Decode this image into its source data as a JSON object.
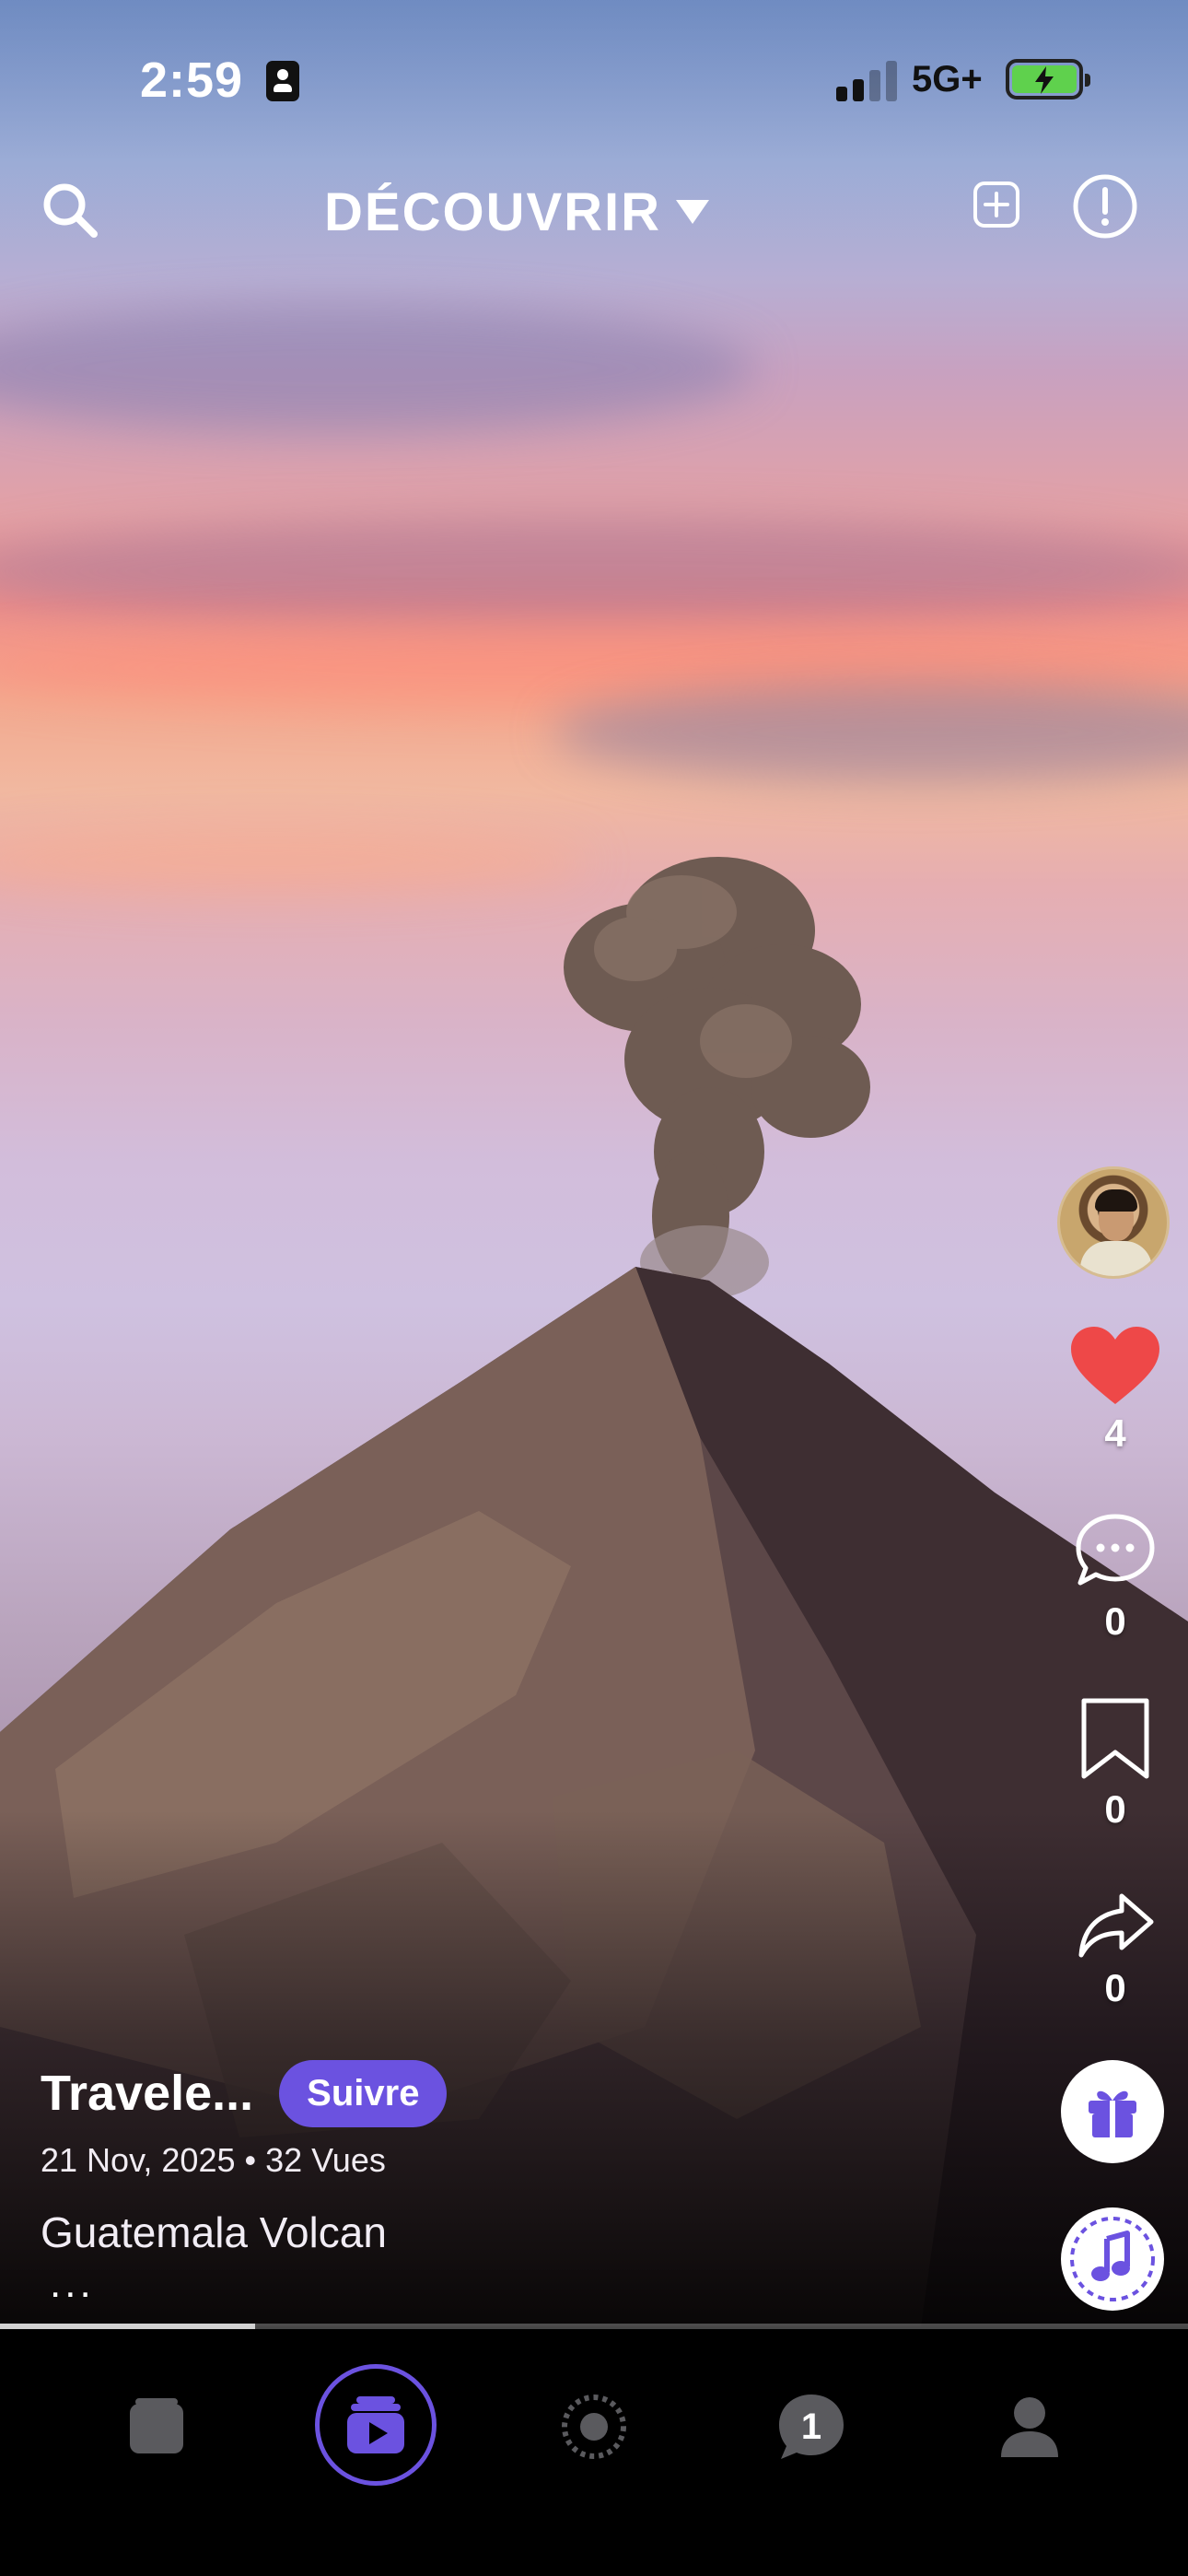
{
  "status_bar": {
    "time": "2:59",
    "network": "5G+",
    "battery_level": 1.0,
    "battery_color": "#5fd14d"
  },
  "header": {
    "title": "DÉCOUVRIR",
    "icons": [
      "search-icon",
      "add-square-icon",
      "report-icon"
    ]
  },
  "post": {
    "username": "Travele...",
    "follow_label": "Suivre",
    "meta": "21 Nov, 2025 • 32 Vues",
    "caption": "Guatemala Volcan",
    "more": "...",
    "progress": 0.215
  },
  "actions": {
    "likes": "4",
    "comments": "0",
    "bookmarks": "0",
    "shares": "0",
    "like_color": "#ee4848"
  },
  "tabbar": {
    "accent": "#6b52e0",
    "notifications_badge": "1",
    "tabs": [
      "stack-icon",
      "video-stack-icon",
      "live-dot-icon",
      "messages-icon",
      "profile-icon"
    ]
  }
}
